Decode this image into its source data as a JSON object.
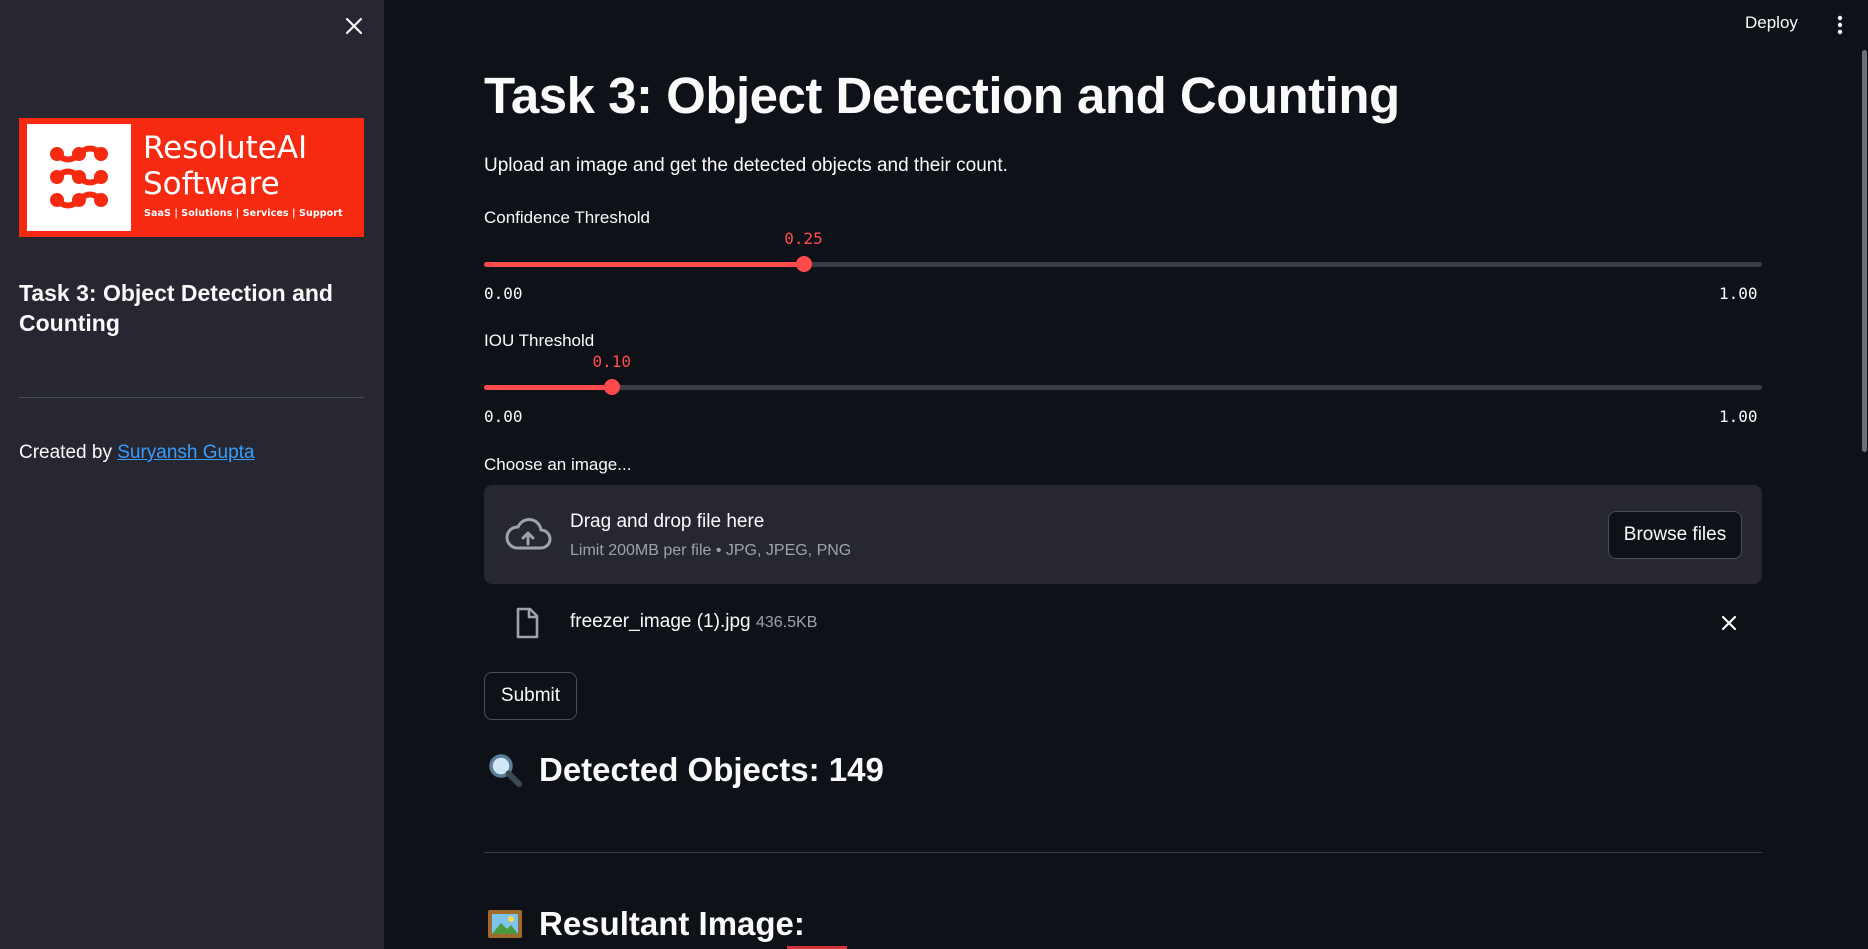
{
  "sidebar": {
    "logo": {
      "name": "ResoluteAI\nSoftware",
      "tagline": "SaaS  |  Solutions  |  Services  |  Support",
      "brand_color": "#f52a10"
    },
    "title": "Task 3: Object Detection and Counting",
    "credit_prefix": "Created by ",
    "credit_link": "Suryansh Gupta"
  },
  "header": {
    "deploy_label": "Deploy"
  },
  "main": {
    "title": "Task 3: Object Detection and Counting",
    "description": "Upload an image and get the detected objects and their count.",
    "sliders": [
      {
        "label": "Confidence Threshold",
        "value": 0.25,
        "value_text": "0.25",
        "min": "0.00",
        "max": "1.00"
      },
      {
        "label": "IOU Threshold",
        "value": 0.1,
        "value_text": "0.10",
        "min": "0.00",
        "max": "1.00"
      }
    ],
    "uploader": {
      "label": "Choose an image...",
      "drop_text": "Drag and drop file here",
      "limit_text": "Limit 200MB per file • JPG, JPEG, PNG",
      "browse_label": "Browse files",
      "file": {
        "name": "freezer_image (1).jpg",
        "size": "436.5KB"
      }
    },
    "submit_label": "Submit",
    "detected_heading": "Detected Objects: 149",
    "result_heading": "Resultant Image:"
  },
  "colors": {
    "accent": "#ff4b4b",
    "link": "#3b9cff",
    "background": "#0e1117",
    "sidebar_bg": "#262730"
  }
}
